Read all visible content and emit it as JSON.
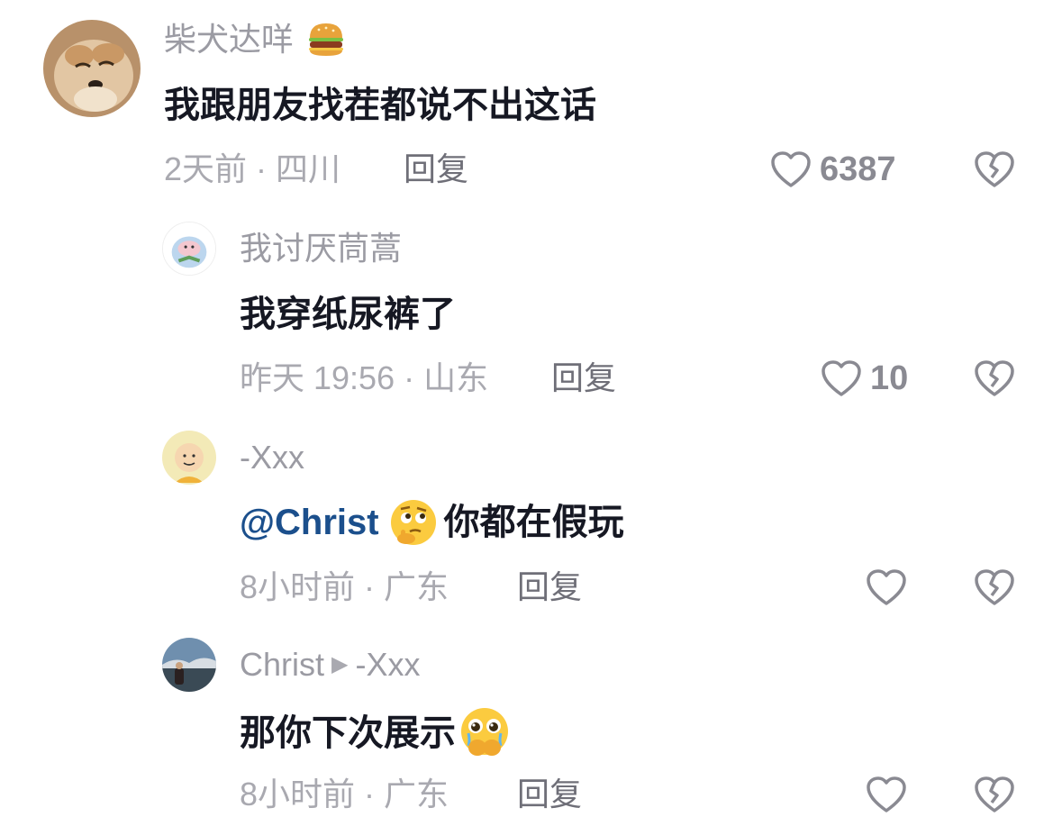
{
  "comments": [
    {
      "username": "柴犬达咩",
      "username_emoji": "hamburger-emoji",
      "text": "我跟朋友找茬都说不出这话",
      "time": "2天前 · 四川",
      "reply_label": "回复",
      "likes": "6387"
    },
    {
      "username": "我讨厌茼蒿",
      "text": "我穿纸尿裤了",
      "time": "昨天 19:56 · 山东",
      "reply_label": "回复",
      "likes": "10"
    },
    {
      "username": "-Xxx",
      "mention": "@Christ",
      "text": "你都在假玩",
      "text_emoji": "thinking-face-emoji",
      "time": "8小时前 · 广东",
      "reply_label": "回复",
      "likes": ""
    },
    {
      "username": "Christ",
      "reply_to": "-Xxx",
      "text": "那你下次展示",
      "text_emoji": "holding-back-tears-emoji",
      "time": "8小时前 · 广东",
      "reply_label": "回复",
      "likes": ""
    }
  ],
  "colors": {
    "text": "#161823",
    "secondary": "#a9a9b0",
    "mention": "#1b4f8c"
  }
}
